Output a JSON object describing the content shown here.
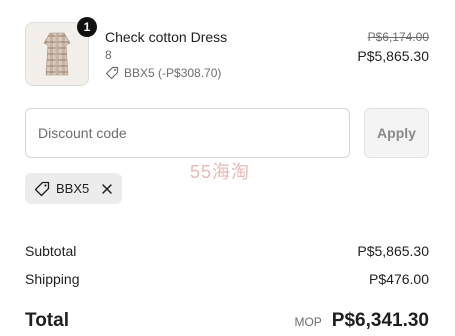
{
  "product": {
    "quantity": "1",
    "name": "Check cotton Dress",
    "variant": "8",
    "discount_label": "BBX5 (-P$308.70)",
    "original_price": "P$6,174.00",
    "final_price": "P$5,865.30",
    "thumb_icon": "dress-product-image"
  },
  "discount": {
    "placeholder": "Discount code",
    "value": "",
    "apply_label": "Apply",
    "applied_code": "BBX5"
  },
  "watermark": "55海淘",
  "summary": {
    "subtotal_label": "Subtotal",
    "subtotal_value": "P$5,865.30",
    "shipping_label": "Shipping",
    "shipping_value": "P$476.00",
    "total_label": "Total",
    "currency": "MOP",
    "total_value": "P$6,341.30"
  },
  "colors": {
    "badge": "#111111",
    "chip_bg": "#ececec",
    "muted_text": "#6e6e6e",
    "watermark": "#e7b9b9"
  }
}
